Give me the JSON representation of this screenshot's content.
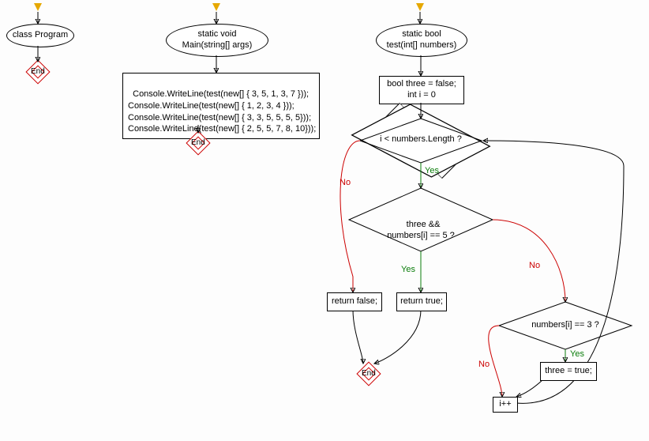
{
  "flow": {
    "classProgram": "class Program",
    "mainSignature": "static void\nMain(string[] args)",
    "mainBody": "Console.WriteLine(test(new[] { 3, 5, 1, 3, 7 }));\nConsole.WriteLine(test(new[] { 1, 2, 3, 4 }));\nConsole.WriteLine(test(new[] { 3, 3, 5, 5, 5, 5}));\nConsole.WriteLine(test(new[] { 2, 5, 5, 7, 8, 10}));",
    "testSignature": "static bool\ntest(int[] numbers)",
    "initBlock": "bool three = false;\nint i = 0",
    "cond1": "i < numbers.Length ?",
    "cond2": "three &&\nnumbers[i] == 5 ?",
    "cond3": "numbers[i] == 3 ?",
    "returnFalse": "return false;",
    "returnTrue": "return true;",
    "setThree": "three = true;",
    "increment": "i++",
    "endLabel": "End",
    "yes": "Yes",
    "no": "No"
  },
  "chart_data": {
    "type": "flowchart",
    "nodes": [
      {
        "id": "entry_prog",
        "type": "entry"
      },
      {
        "id": "class_program",
        "type": "ellipse",
        "text": "class Program"
      },
      {
        "id": "end1",
        "type": "end",
        "text": "End"
      },
      {
        "id": "entry_main",
        "type": "entry"
      },
      {
        "id": "main_sig",
        "type": "ellipse",
        "text": "static void Main(string[] args)"
      },
      {
        "id": "main_body",
        "type": "process",
        "text": "Console.WriteLine(test(new[] { 3, 5, 1, 3, 7 })); Console.WriteLine(test(new[] { 1, 2, 3, 4 })); Console.WriteLine(test(new[] { 3, 3, 5, 5, 5, 5})); Console.WriteLine(test(new[] { 2, 5, 5, 7, 8, 10}));"
      },
      {
        "id": "end2",
        "type": "end",
        "text": "End"
      },
      {
        "id": "entry_test",
        "type": "entry"
      },
      {
        "id": "test_sig",
        "type": "ellipse",
        "text": "static bool test(int[] numbers)"
      },
      {
        "id": "init",
        "type": "process",
        "text": "bool three = false; int i = 0"
      },
      {
        "id": "cond_len",
        "type": "decision",
        "text": "i < numbers.Length ?"
      },
      {
        "id": "cond_three5",
        "type": "decision",
        "text": "three && numbers[i] == 5 ?"
      },
      {
        "id": "return_false",
        "type": "process",
        "text": "return false;"
      },
      {
        "id": "return_true",
        "type": "process",
        "text": "return true;"
      },
      {
        "id": "end3",
        "type": "end",
        "text": "End"
      },
      {
        "id": "cond_eq3",
        "type": "decision",
        "text": "numbers[i] == 3 ?"
      },
      {
        "id": "set_three",
        "type": "process",
        "text": "three = true;"
      },
      {
        "id": "inc",
        "type": "process",
        "text": "i++"
      }
    ],
    "edges": [
      {
        "from": "entry_prog",
        "to": "class_program"
      },
      {
        "from": "class_program",
        "to": "end1"
      },
      {
        "from": "entry_main",
        "to": "main_sig"
      },
      {
        "from": "main_sig",
        "to": "main_body"
      },
      {
        "from": "main_body",
        "to": "end2"
      },
      {
        "from": "entry_test",
        "to": "test_sig"
      },
      {
        "from": "test_sig",
        "to": "init"
      },
      {
        "from": "init",
        "to": "cond_len"
      },
      {
        "from": "cond_len",
        "to": "cond_three5",
        "label": "Yes"
      },
      {
        "from": "cond_len",
        "to": "return_false",
        "label": "No"
      },
      {
        "from": "cond_three5",
        "to": "return_true",
        "label": "Yes"
      },
      {
        "from": "cond_three5",
        "to": "cond_eq3",
        "label": "No"
      },
      {
        "from": "cond_eq3",
        "to": "set_three",
        "label": "Yes"
      },
      {
        "from": "cond_eq3",
        "to": "inc",
        "label": "No"
      },
      {
        "from": "set_three",
        "to": "inc"
      },
      {
        "from": "inc",
        "to": "cond_len"
      },
      {
        "from": "return_false",
        "to": "end3"
      },
      {
        "from": "return_true",
        "to": "end3"
      }
    ]
  }
}
